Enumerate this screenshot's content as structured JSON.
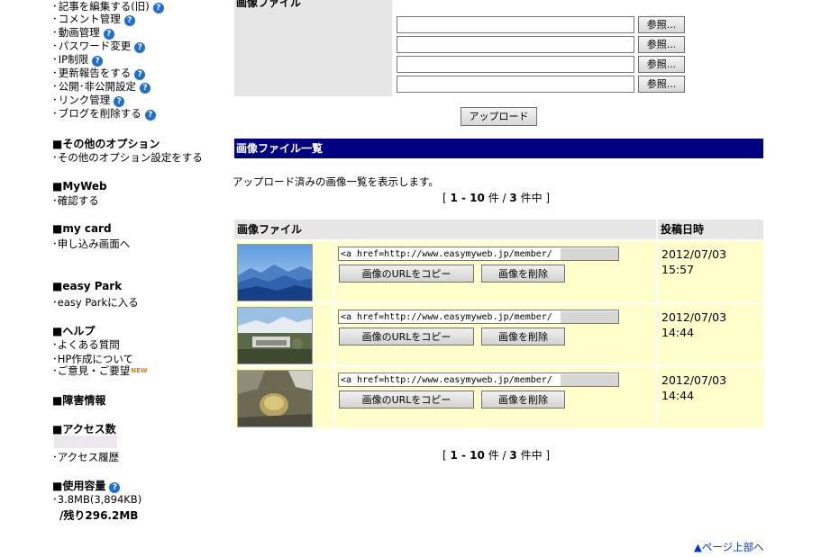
{
  "sidebar": {
    "blog_items": [
      {
        "label": "記事を編集する(旧)",
        "help": true
      },
      {
        "label": "コメント管理",
        "help": true
      },
      {
        "label": "動画管理",
        "help": true
      },
      {
        "label": "パスワード変更",
        "help": true
      },
      {
        "label": "IP制限",
        "help": true
      },
      {
        "label": "更新報告をする",
        "help": true
      },
      {
        "label": "公開･非公開設定",
        "help": true
      },
      {
        "label": "リンク管理",
        "help": true
      },
      {
        "label": "ブログを削除する",
        "help": true
      }
    ],
    "other_options": {
      "heading": "■その他のオプション",
      "link": "その他のオプション設定をする"
    },
    "myweb": {
      "heading": "■MyWeb",
      "link": "確認する"
    },
    "mycard": {
      "heading": "■my card",
      "link": "申し込み画面へ"
    },
    "easypark": {
      "heading": "■easy Park",
      "link": "easy Parkに入る"
    },
    "help": {
      "heading": "■ヘルプ",
      "links": [
        "よくある質問",
        "HP作成について",
        "ご意見・ご要望"
      ],
      "new_badge": "NEW"
    },
    "trouble": {
      "heading": "■障害情報"
    },
    "access": {
      "heading": "■アクセス数",
      "link": "アクセス履歴"
    },
    "usage": {
      "heading": "■使用容量",
      "used": "3.8MB(3,894KB)",
      "remaining": "/残り296.2MB"
    }
  },
  "upload": {
    "title": "画像ファイル",
    "browse_label": "参照...",
    "upload_label": "アップロード"
  },
  "list": {
    "section_title": "画像ファイル一覧",
    "description": "アップロード済みの画像一覧を表示します。",
    "pager": {
      "open": "[ ",
      "range": "1 - 10",
      "unit": " 件 / ",
      "total": "3",
      "close": " 件中 ]"
    },
    "col_file": "画像ファイル",
    "col_date": "投稿日時",
    "copy_label": "画像のURLをコピー",
    "delete_label": "画像を削除",
    "rows": [
      {
        "url": "<a href=http://www.easymyweb.jp/member/",
        "date": "2012/07/03",
        "time": "15:57"
      },
      {
        "url": "<a href=http://www.easymyweb.jp/member/",
        "date": "2012/07/03",
        "time": "14:44"
      },
      {
        "url": "<a href=http://www.easymyweb.jp/member/",
        "date": "2012/07/03",
        "time": "14:44"
      }
    ]
  },
  "page_top": "▲ページ上部へ",
  "colors": {
    "header_bar": "#000080",
    "row_bg": "#ffffcc",
    "link": "#0033cc",
    "help_icon": "#1f6fd1"
  }
}
